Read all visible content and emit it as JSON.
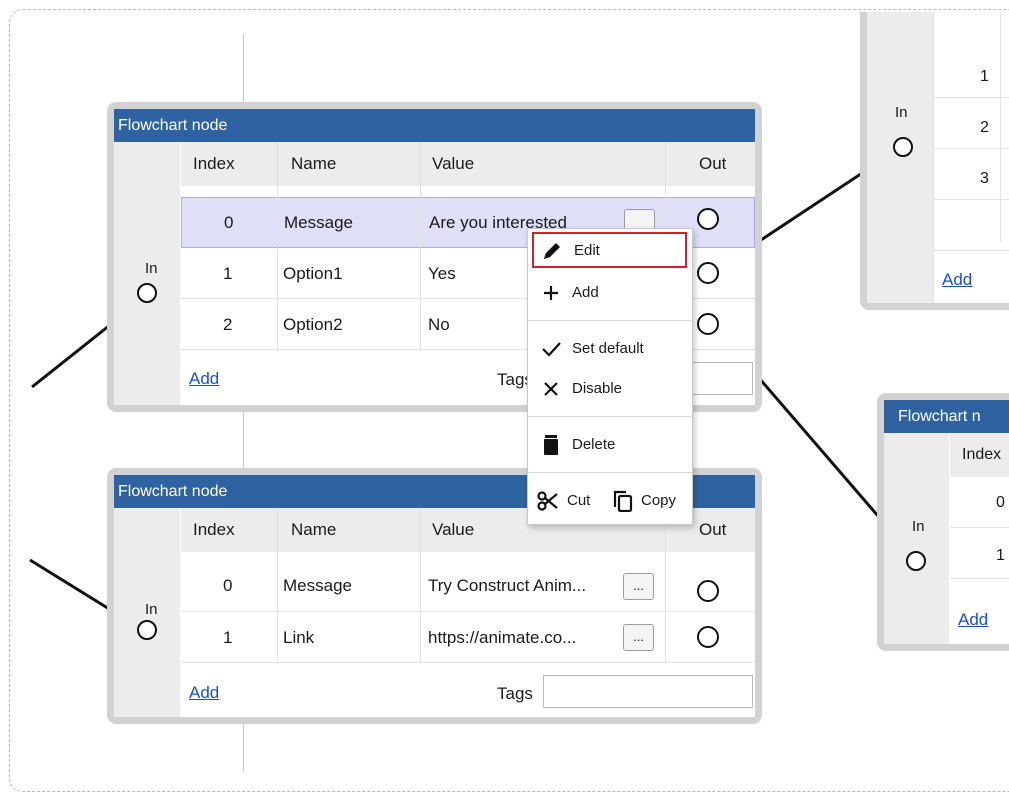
{
  "colors": {
    "title_bar": "#2f62a0",
    "selected_row": "#dfe0f8",
    "highlight_border": "#d2202e",
    "link": "#1a4fc9"
  },
  "node1": {
    "title": "Flowchart node",
    "in_label": "In",
    "headers": {
      "index": "Index",
      "name": "Name",
      "value": "Value",
      "out": "Out"
    },
    "rows": [
      {
        "index": "0",
        "name": "Message",
        "value": "Are you interested"
      },
      {
        "index": "1",
        "name": "Option1",
        "value": "Yes"
      },
      {
        "index": "2",
        "name": "Option2",
        "value": "No"
      }
    ],
    "add_label": "Add",
    "tags_label": "Tags"
  },
  "node2": {
    "title": "Flowchart node",
    "in_label": "In",
    "headers": {
      "index": "Index",
      "name": "Name",
      "value": "Value",
      "out": "Out"
    },
    "rows": [
      {
        "index": "0",
        "name": "Message",
        "value": "Try Construct Anim...",
        "button": "..."
      },
      {
        "index": "1",
        "name": "Link",
        "value": "https://animate.co...",
        "button": "..."
      }
    ],
    "add_label": "Add",
    "tags_label": "Tags"
  },
  "node3": {
    "in_label": "In",
    "rows": [
      {
        "index": "1"
      },
      {
        "index": "2"
      },
      {
        "index": "3"
      }
    ],
    "add_label": "Add"
  },
  "node4": {
    "title": "Flowchart n",
    "in_label": "In",
    "header_index": "Index",
    "rows": [
      {
        "index": "0"
      },
      {
        "index": "1"
      }
    ],
    "add_label": "Add"
  },
  "context_menu": {
    "items": [
      {
        "label": "Edit",
        "icon": "pencil-icon",
        "highlighted": true
      },
      {
        "label": "Add",
        "icon": "plus-icon"
      },
      {
        "label": "Set default",
        "icon": "checkmark-icon"
      },
      {
        "label": "Disable",
        "icon": "x-icon"
      },
      {
        "label": "Delete",
        "icon": "trash-icon"
      },
      {
        "label": "Cut",
        "icon": "scissors-icon"
      },
      {
        "label": "Copy",
        "icon": "copy-icon"
      }
    ]
  }
}
